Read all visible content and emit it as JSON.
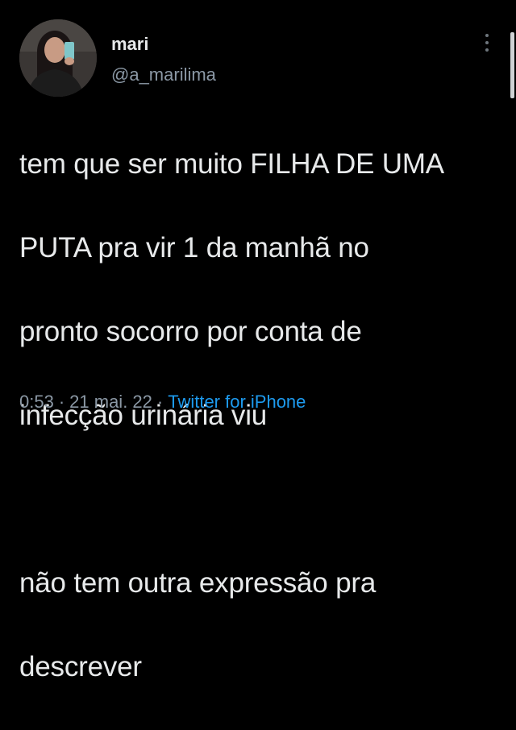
{
  "tweet": {
    "author": {
      "name": "mari",
      "handle": "@a_marilima",
      "avatar_icon": "profile-photo"
    },
    "more_icon": "more-vertical-icon",
    "lines": [
      "tem que ser muito FILHA DE UMA",
      "PUTA pra vir 1 da manhã no",
      "pronto socorro por conta de",
      "infecção urinária viu",
      "",
      "não tem outra expressão pra",
      "descrever"
    ],
    "meta": {
      "time": "0:53",
      "separator": "·",
      "date": "21 mai. 22",
      "source": "Twitter for iPhone"
    }
  },
  "colors": {
    "background": "#000000",
    "primary_text": "#e7e9ea",
    "secondary_text": "#8b98a5",
    "link": "#1d9bf0"
  }
}
